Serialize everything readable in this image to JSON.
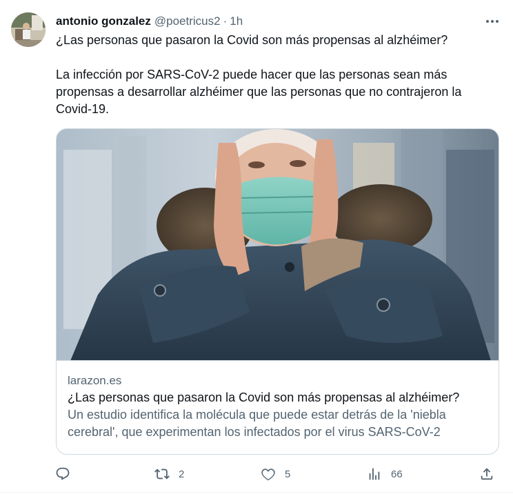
{
  "tweet": {
    "author_name": "antonio gonzalez",
    "author_handle": "@poetricus2",
    "separator": "·",
    "time": "1h",
    "text_line1": "¿Las personas que pasaron la Covid son más propensas al alzhéimer?",
    "text_line2": "La infección por SARS-CoV-2 puede hacer que las personas sean más propensas a desarrollar alzhéimer que las personas que no contrajeron la Covid-19."
  },
  "card": {
    "domain": "larazon.es",
    "title": "¿Las personas que pasaron la Covid son más propensas al alzhéimer?",
    "description": "Un estudio identifica la molécula que puede estar detrás de la 'niebla cerebral', que experimentan los infectados por el virus SARS-CoV-2"
  },
  "actions": {
    "reply_count": "",
    "retweet_count": "2",
    "like_count": "5",
    "views_count": "66"
  },
  "colors": {
    "text_primary": "#0f1419",
    "text_secondary": "#536471",
    "border": "#cfd9de"
  },
  "icons": [
    "more-icon",
    "reply-icon",
    "retweet-icon",
    "like-icon",
    "views-icon",
    "share-icon"
  ]
}
